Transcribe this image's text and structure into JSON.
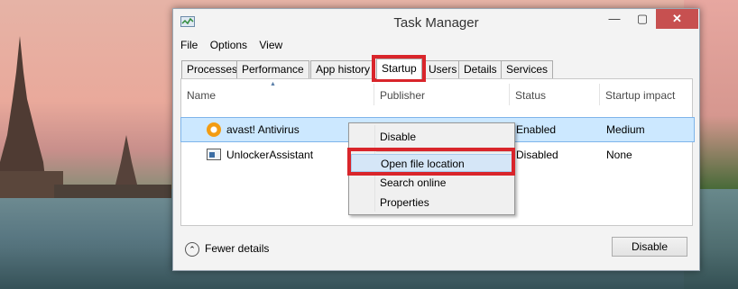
{
  "window": {
    "title": "Task Manager",
    "controls": {
      "minimize": "—",
      "maximize": "▢",
      "close": "✕"
    }
  },
  "menu": [
    "File",
    "Options",
    "View"
  ],
  "tabs": [
    "Processes",
    "Performance",
    "App history",
    "Startup",
    "Users",
    "Details",
    "Services"
  ],
  "active_tab": "Startup",
  "columns": [
    "Name",
    "Publisher",
    "Status",
    "Startup impact"
  ],
  "rows": [
    {
      "name": "avast! Antivirus",
      "publisher": "",
      "status": "Enabled",
      "impact": "Medium",
      "icon": "avast-icon",
      "selected": true
    },
    {
      "name": "UnlockerAssistant",
      "publisher": "",
      "status": "Disabled",
      "impact": "None",
      "icon": "unlocker-icon",
      "selected": false
    }
  ],
  "context_menu": {
    "items": [
      "Disable",
      "Open file location",
      "Search online",
      "Properties"
    ],
    "highlighted": "Open file location"
  },
  "footer": {
    "fewer_details": "Fewer details",
    "disable_button": "Disable"
  },
  "colors": {
    "selection": "#cce8ff",
    "highlight_box": "#d9252b",
    "close_button": "#c75050"
  }
}
